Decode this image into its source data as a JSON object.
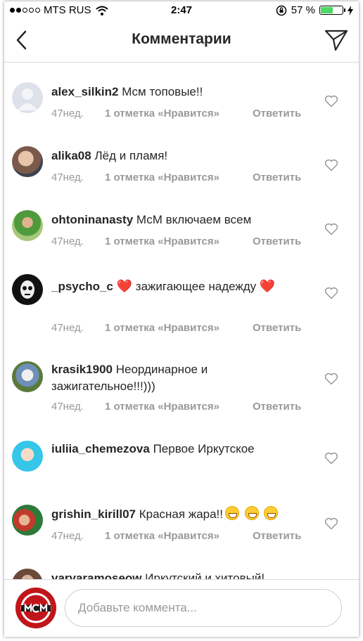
{
  "status_bar": {
    "carrier": "MTS RUS",
    "time": "2:47",
    "battery_percent": "57 %",
    "battery_level": 0.57
  },
  "header": {
    "title": "Комментарии"
  },
  "comments": [
    {
      "username": "alex_silkin2",
      "text": "Мсм топовые!!",
      "time": "47нед.",
      "likes": "1 отметка «Нравится»",
      "reply": "Ответить",
      "emoji": ""
    },
    {
      "username": "alika08",
      "text": "Лёд и пламя!",
      "time": "47нед.",
      "likes": "1 отметка «Нравится»",
      "reply": "Ответить",
      "emoji": ""
    },
    {
      "username": "ohtoninanasty",
      "text": "МсМ включаем всем",
      "time": "47нед.",
      "likes": "1 отметка «Нравится»",
      "reply": "Ответить",
      "emoji": ""
    },
    {
      "username": "_psycho_c",
      "text": "зажигающее надежду",
      "time": "47нед.",
      "likes": "1 отметка «Нравится»",
      "reply": "Ответить",
      "emoji": "❤️"
    },
    {
      "username": "krasik1900",
      "text": "Неординарное и зажигательное!!!)))",
      "time": "47нед.",
      "likes": "1 отметка «Нравится»",
      "reply": "Ответить",
      "emoji": ""
    },
    {
      "username": "iuliia_chemezova",
      "text": "Первое Иркутское",
      "time": "",
      "likes": "",
      "reply": "",
      "emoji": ""
    },
    {
      "username": "grishin_kirill07",
      "text": "Красная жара!!",
      "time": "47нед.",
      "likes": "1 отметка «Нравится»",
      "reply": "Ответить",
      "emoji": "😆😄😄"
    },
    {
      "username": "varvaramosеоw",
      "text": "Иркутский и хитовый!",
      "time": "",
      "likes": "",
      "reply": "",
      "emoji": ""
    }
  ],
  "input": {
    "placeholder": "Добавьте коммента..."
  },
  "colors": {
    "text": "#262626",
    "meta": "#999999",
    "divider": "#dbdbdb",
    "battery": "#4cd964",
    "heart_emoji": "#e0245e"
  }
}
